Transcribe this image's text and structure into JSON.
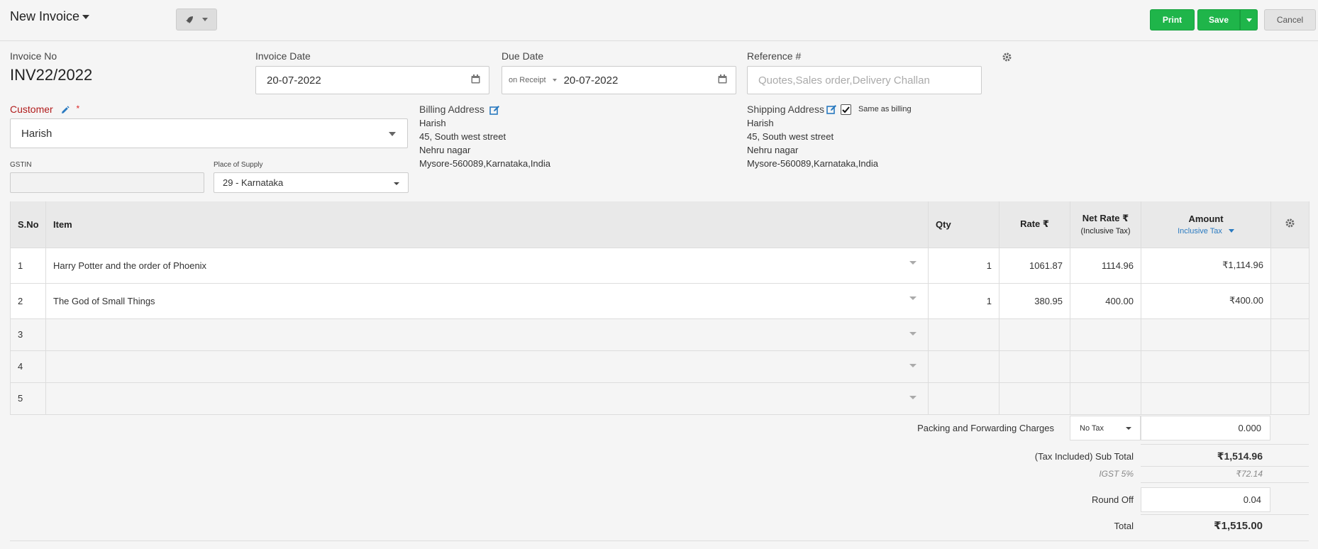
{
  "header": {
    "title": "New Invoice",
    "print_label": "Print",
    "save_label": "Save",
    "cancel_label": "Cancel"
  },
  "invoice": {
    "no_label": "Invoice No",
    "no_value": "INV22/2022",
    "date_label": "Invoice Date",
    "date_value": "20-07-2022",
    "due_label": "Due Date",
    "due_terms": "on Receipt",
    "due_value": "20-07-2022",
    "reference_label": "Reference #",
    "reference_placeholder": "Quotes,Sales order,Delivery Challan"
  },
  "customer": {
    "label": "Customer",
    "required_mark": "*",
    "value": "Harish",
    "gstin_label": "GSTIN",
    "gstin_value": "",
    "supply_label": "Place of Supply",
    "supply_value": "29 - Karnataka"
  },
  "billing": {
    "label": "Billing Address",
    "lines": [
      "Harish",
      "45, South west street",
      "Nehru nagar",
      "Mysore-560089,Karnataka,India"
    ]
  },
  "shipping": {
    "label": "Shipping Address",
    "same_label": "Same as billing",
    "same_checked": true,
    "lines": [
      "Harish",
      "45, South west street",
      "Nehru nagar",
      "Mysore-560089,Karnataka,India"
    ]
  },
  "table": {
    "headers": {
      "sno": "S.No",
      "item": "Item",
      "qty": "Qty",
      "rate": "Rate ₹",
      "net_rate": "Net Rate ₹",
      "net_rate_sub": "(Inclusive Tax)",
      "amount": "Amount",
      "amount_sub": "Inclusive Tax"
    },
    "rows": [
      {
        "sno": "1",
        "item": "Harry Potter and the order of Phoenix",
        "qty": "1",
        "rate": "1061.87",
        "net_rate": "1114.96",
        "amount": "₹1,114.96"
      },
      {
        "sno": "2",
        "item": "The God of Small Things",
        "qty": "1",
        "rate": "380.95",
        "net_rate": "400.00",
        "amount": "₹400.00"
      },
      {
        "sno": "3",
        "item": "",
        "qty": "",
        "rate": "",
        "net_rate": "",
        "amount": ""
      },
      {
        "sno": "4",
        "item": "",
        "qty": "",
        "rate": "",
        "net_rate": "",
        "amount": ""
      },
      {
        "sno": "5",
        "item": "",
        "qty": "",
        "rate": "",
        "net_rate": "",
        "amount": ""
      }
    ]
  },
  "totals": {
    "packing_label": "Packing and Forwarding Charges",
    "packing_tax": "No Tax",
    "packing_value": "0.000",
    "subtotal_label": "(Tax Included) Sub Total",
    "subtotal_value": "₹1,514.96",
    "igst_label": "IGST 5%",
    "igst_value": "₹72.14",
    "roundoff_label": "Round Off",
    "roundoff_value": "0.04",
    "total_label": "Total",
    "total_value": "₹1,515.00"
  },
  "colors": {
    "accent_green": "#1fb54a",
    "link_blue": "#2a7ac0",
    "required_red": "#b11c1c"
  }
}
